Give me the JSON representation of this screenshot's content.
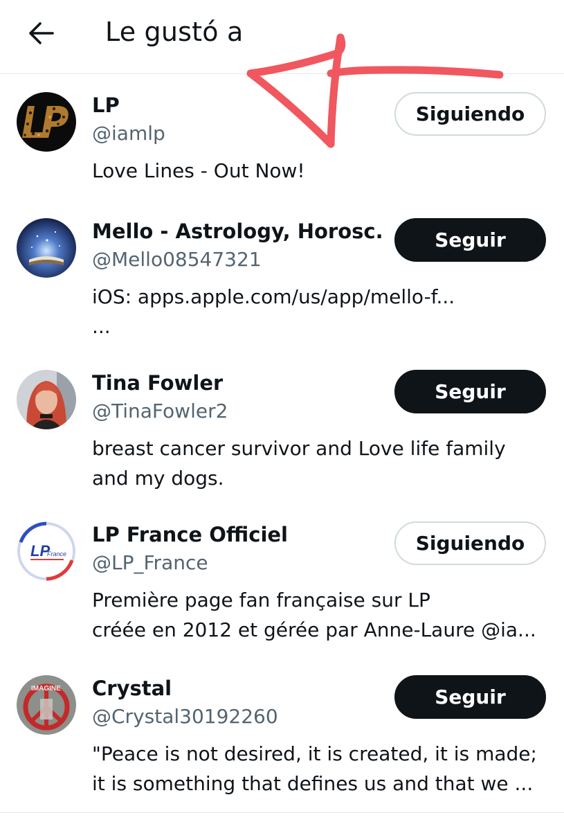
{
  "header": {
    "title": "Le gustó a",
    "back_icon": "arrow-left-icon"
  },
  "colors": {
    "primary_text": "#0f1419",
    "secondary_text": "#536471",
    "follow_button_bg": "#0f1419",
    "following_button_border": "#cfd9de",
    "annotation_stroke": "#f0575e"
  },
  "users": [
    {
      "name": "LP",
      "handle": "@iamlp",
      "bio": "Love Lines - Out Now!",
      "button": "Siguiendo",
      "following": true
    },
    {
      "name": "Mello - Astrology, Horosc...",
      "handle": "@Mello08547321",
      "bio": "iOS: apps.apple.com/us/app/mello-f...\n...",
      "button": "Seguir",
      "following": false
    },
    {
      "name": "Tina Fowler",
      "handle": "@TinaFowler2",
      "bio": "breast cancer survivor and Love life family\nand my dogs.",
      "button": "Seguir",
      "following": false
    },
    {
      "name": "LP France Officiel",
      "handle": "@LP_France",
      "bio": "Première page fan française sur LP\ncréée en 2012 et gérée par Anne-Laure  @ia...",
      "button": "Siguiendo",
      "following": true,
      "avatar_logo_text": "LP",
      "avatar_logo_subtext": "France"
    },
    {
      "name": "Crystal",
      "handle": "@Crystal30192260",
      "bio": "\"Peace is not desired, it is created, it is made;\nit is something that defines us and that we ...",
      "button": "Seguir",
      "following": false,
      "avatar_logo_text": "IMAGINE"
    }
  ]
}
